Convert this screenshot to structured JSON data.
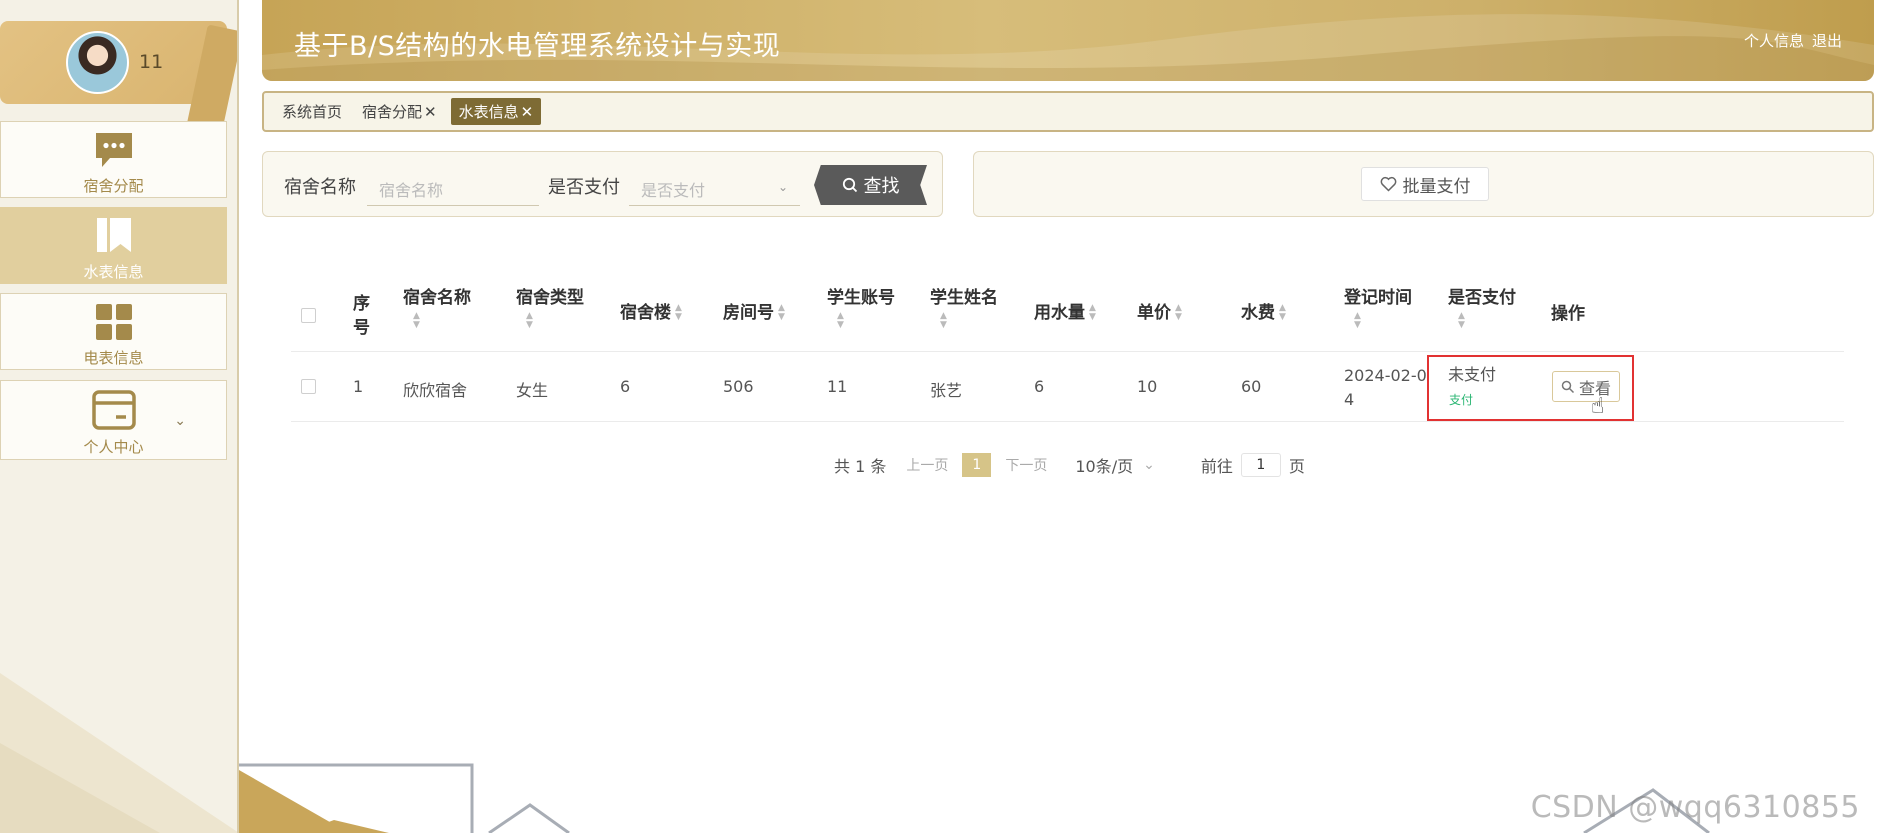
{
  "app": {
    "title": "基于B/S结构的水电管理系统设计与实现",
    "header_links": [
      "个人信息",
      "退出"
    ]
  },
  "user": {
    "name": "11"
  },
  "sidebar": {
    "items": [
      {
        "label": "宿舍分配",
        "icon": "chat-icon",
        "active": false
      },
      {
        "label": "水表信息",
        "icon": "bookmark-icon",
        "active": true
      },
      {
        "label": "电表信息",
        "icon": "grid-icon",
        "active": false
      },
      {
        "label": "个人中心",
        "icon": "card-icon",
        "active": false
      }
    ]
  },
  "tabs": [
    {
      "label": "系统首页",
      "closable": false
    },
    {
      "label": "宿舍分配",
      "closable": true
    },
    {
      "label": "水表信息",
      "closable": true,
      "active": true
    }
  ],
  "search": {
    "name_label": "宿舍名称",
    "name_placeholder": "宿舍名称",
    "paid_label": "是否支付",
    "paid_placeholder": "是否支付",
    "search_button": "查找"
  },
  "batch": {
    "pay_button": "批量支付"
  },
  "table": {
    "headers": [
      "序号",
      "宿舍名称",
      "宿舍类型",
      "宿舍楼",
      "房间号",
      "学生账号",
      "学生姓名",
      "用水量",
      "单价",
      "水费",
      "登记时间",
      "是否支付",
      "操作"
    ],
    "header_seq_line1": "序",
    "header_seq_line2": "号",
    "rows": [
      {
        "index": "1",
        "dorm_name": "欣欣宿舍",
        "dorm_type": "女生",
        "building": "6",
        "room": "506",
        "account": "11",
        "student": "张艺",
        "usage": "6",
        "price": "10",
        "fee": "60",
        "time_line1": "2024-02-0",
        "time_line2": "4",
        "paid_status": "未支付",
        "pay_link": "支付",
        "view_button": "查看"
      }
    ]
  },
  "pager": {
    "total": "共 1 条",
    "prev": "上一页",
    "page": "1",
    "next": "下一页",
    "page_size": "10条/页",
    "goto_label": "前往",
    "goto_value": "1",
    "goto_suffix": "页"
  },
  "watermark": "CSDN @wqq6310855",
  "colors": {
    "accent": "#c6a456",
    "active_tab": "#7e6b34",
    "highlight": "#e23232",
    "pay_link": "#2bb673"
  }
}
